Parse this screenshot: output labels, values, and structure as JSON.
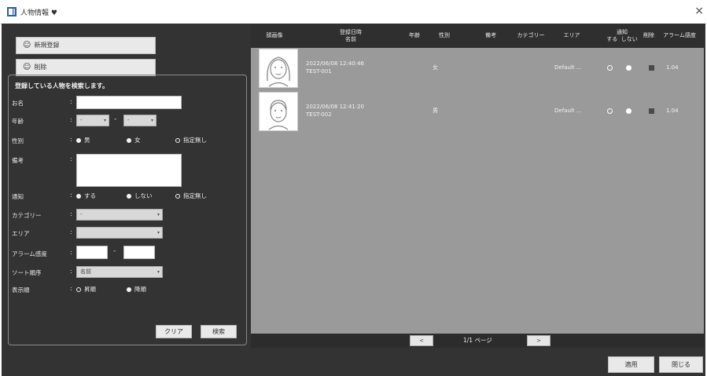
{
  "window": {
    "title": "人物情報",
    "title_marker": "♥",
    "close_glyph": "×"
  },
  "left": {
    "add_person_label": "新規登録",
    "delete_label": "削除",
    "search": {
      "heading": "登録している人物を検索します。",
      "labels": {
        "name": "お名",
        "age": "年齢",
        "gender": "性別",
        "memo": "備考",
        "notify": "通知",
        "category": "カテゴリー",
        "area": "エリア",
        "alarm_level": "アラーム感度",
        "sort": "ソート順序",
        "order": "表示順"
      },
      "age_from": "-",
      "age_to": "-",
      "gender_options": [
        "男",
        "女",
        "指定無し"
      ],
      "notify_options": [
        "する",
        "しない",
        "指定無し"
      ],
      "category_value": "-",
      "area_value": "",
      "sort_value": "名前",
      "order_options": [
        "昇順",
        "降順"
      ],
      "clear_label": "クリア",
      "search_label": "検索"
    }
  },
  "grid": {
    "columns": [
      "顔画像",
      "登録日時\n名前",
      "年齢",
      "性別",
      "備考",
      "カテゴリー",
      "エリア",
      "通知\nする  しない",
      "削除",
      "アラーム感度"
    ],
    "rows": [
      {
        "datetime": "2022/06/08 12:40:46",
        "name": "TEST-001",
        "gender": "女",
        "area": "Default ...",
        "alarm": "1.04"
      },
      {
        "datetime": "2022/06/08 12:41:20",
        "name": "TEST-002",
        "gender": "男",
        "area": "Default ...",
        "alarm": "1.04"
      }
    ],
    "pagination": {
      "prev": "<",
      "next": ">",
      "text": "1/1 ページ"
    }
  },
  "bottom": {
    "apply_label": "適用",
    "close_label": "閉じる"
  },
  "colors": {
    "window_bg": "#333333",
    "grid_bg": "#9a9a9a"
  }
}
